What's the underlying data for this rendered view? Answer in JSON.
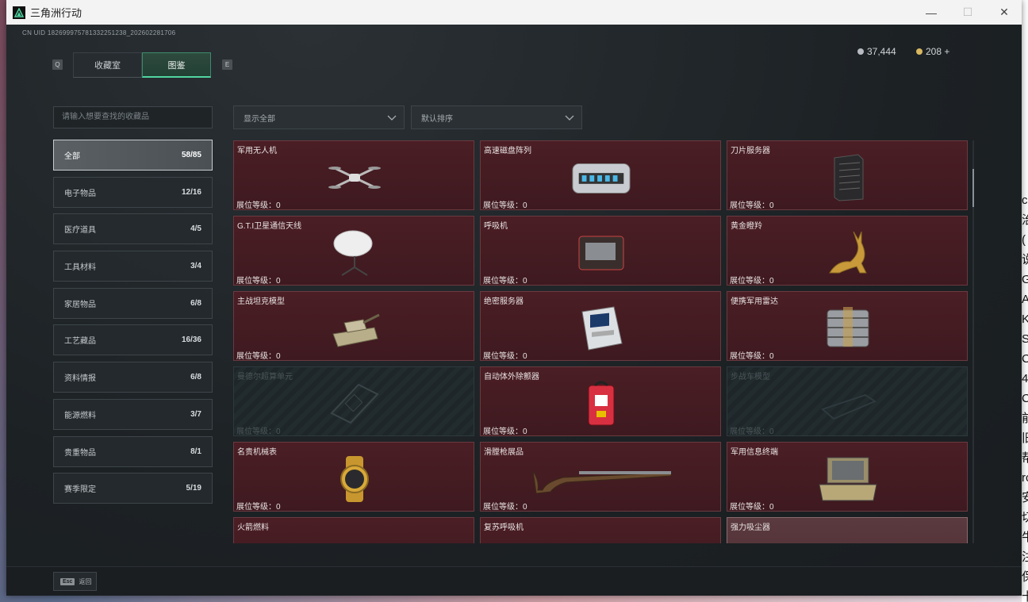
{
  "window": {
    "title": "三角洲行动",
    "minimize": "—",
    "maximize": "☐",
    "close": "✕"
  },
  "header": {
    "uid": "CN UID 1826999757813322512​38_202602281706",
    "tabs": [
      {
        "label": "收藏室",
        "key": "Q",
        "active": false
      },
      {
        "label": "图鉴",
        "key": "E",
        "active": true
      }
    ],
    "tab_key_left": "Q",
    "tab_key_right": "E",
    "currency": [
      {
        "value": "37,444",
        "icon": "silver-coin-icon",
        "color": "#b8bcc2"
      },
      {
        "value": "208 +",
        "icon": "gold-coin-icon",
        "color": "#d8b860"
      }
    ]
  },
  "search": {
    "placeholder": "请输入想要查找的收藏品"
  },
  "filters": {
    "display": "显示全部",
    "sort": "默认排序"
  },
  "categories": [
    {
      "label": "全部",
      "count": "58/85",
      "active": true
    },
    {
      "label": "电子物品",
      "count": "12/16"
    },
    {
      "label": "医疗道具",
      "count": "4/5"
    },
    {
      "label": "工具材料",
      "count": "3/4"
    },
    {
      "label": "家居物品",
      "count": "6/8"
    },
    {
      "label": "工艺藏品",
      "count": "16/36"
    },
    {
      "label": "资料情报",
      "count": "6/8"
    },
    {
      "label": "能源燃料",
      "count": "3/7"
    },
    {
      "label": "贵重物品",
      "count": "8/1"
    },
    {
      "label": "赛季限定",
      "count": "5/19"
    }
  ],
  "level_label": "展位等级：",
  "items": [
    {
      "name": "军用无人机",
      "level": "0",
      "state": "owned",
      "icon": "drone-icon"
    },
    {
      "name": "高速磁盘阵列",
      "level": "0",
      "state": "owned",
      "icon": "disk-array-icon"
    },
    {
      "name": "刀片服务器",
      "level": "0",
      "state": "owned",
      "icon": "blade-server-icon"
    },
    {
      "name": "G.T.I卫星通信天线",
      "level": "0",
      "state": "owned",
      "icon": "satellite-dish-icon"
    },
    {
      "name": "呼吸机",
      "level": "0",
      "state": "owned",
      "icon": "ventilator-icon"
    },
    {
      "name": "黄金瞪羚",
      "level": "0",
      "state": "owned",
      "icon": "gold-gazelle-icon"
    },
    {
      "name": "主战坦克模型",
      "level": "0",
      "state": "owned",
      "icon": "tank-model-icon"
    },
    {
      "name": "绝密服务器",
      "level": "0",
      "state": "owned",
      "icon": "secret-server-icon"
    },
    {
      "name": "便携军用雷达",
      "level": "0",
      "state": "owned",
      "icon": "portable-radar-icon"
    },
    {
      "name": "曼德尔超算单元",
      "level": "0",
      "state": "locked",
      "icon": "supercomputer-icon"
    },
    {
      "name": "自动体外除颤器",
      "level": "0",
      "state": "owned",
      "icon": "defibrillator-icon"
    },
    {
      "name": "步战车模型",
      "level": "0",
      "state": "locked",
      "icon": "ifv-model-icon"
    },
    {
      "name": "名贵机械表",
      "level": "0",
      "state": "owned",
      "icon": "watch-icon"
    },
    {
      "name": "滑膛枪展品",
      "level": "0",
      "state": "owned",
      "icon": "musket-icon"
    },
    {
      "name": "军用信息终端",
      "level": "0",
      "state": "owned",
      "icon": "info-terminal-icon"
    },
    {
      "name": "火箭燃料",
      "level": "",
      "state": "owned",
      "icon": "rocket-fuel-icon"
    },
    {
      "name": "复苏呼吸机",
      "level": "",
      "state": "owned",
      "icon": "resuscitator-icon"
    },
    {
      "name": "强力吸尘器",
      "level": "",
      "state": "light",
      "icon": "vacuum-icon"
    }
  ],
  "bottom": {
    "esc_key": "Esc",
    "esc_label": "返回"
  },
  "desktop_strip": "c 治 ( 说 G A K S C 4 C 前 旧 帮 rc 安 切 牛 注 保 卡"
}
